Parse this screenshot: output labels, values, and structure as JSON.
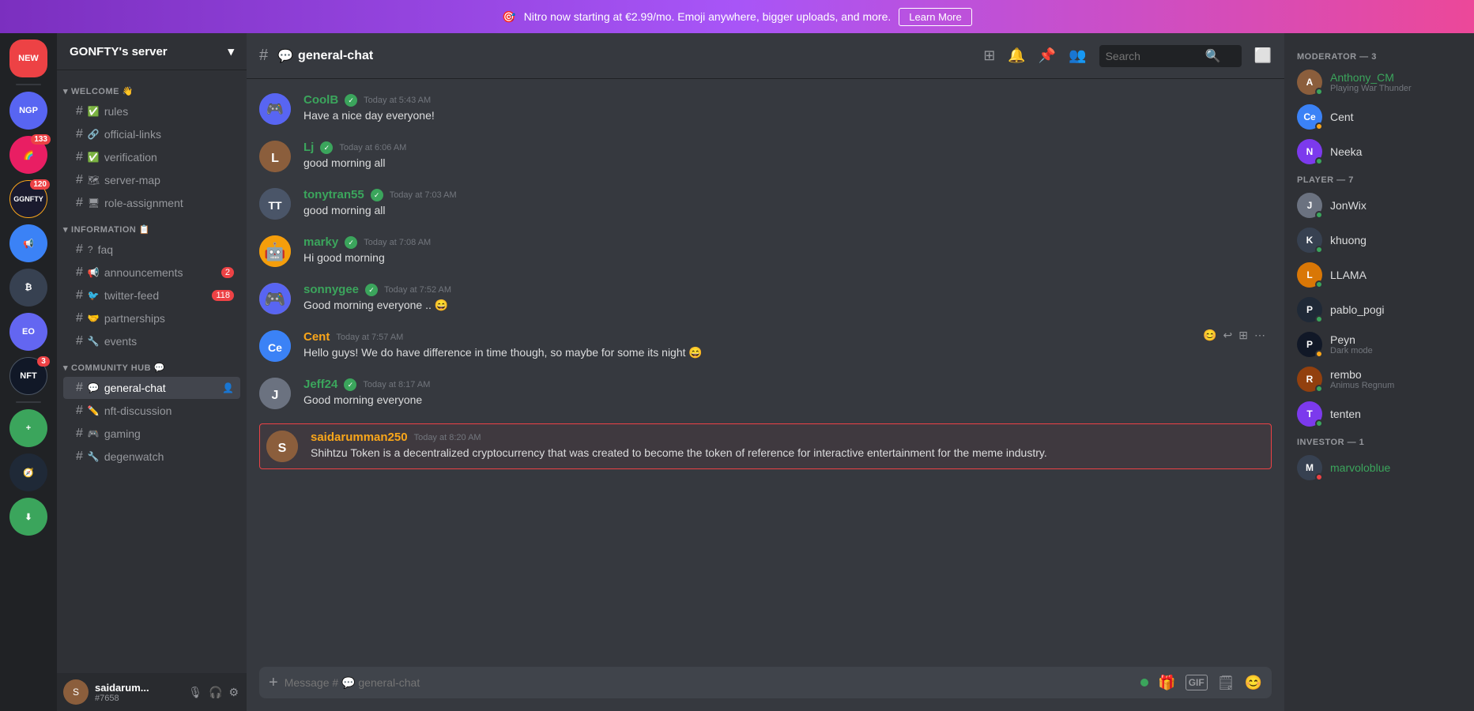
{
  "banner": {
    "text": "Nitro now starting at €2.99/mo. Emoji anywhere, bigger uploads, and more.",
    "cta": "Learn More",
    "icon": "🎯"
  },
  "server": {
    "name": "GONFTY's server",
    "header_icon": "🟡"
  },
  "server_icons": [
    {
      "id": "new",
      "label": "NEW",
      "color": "#ed4245",
      "badge": null
    },
    {
      "id": "ngp",
      "label": "NGP",
      "color": "#5865f2",
      "badge": null
    },
    {
      "id": "arc",
      "label": "🌈",
      "color": "#e91e63",
      "badge": "133"
    },
    {
      "id": "ggnfty",
      "label": "GGNFTY",
      "color": "#1a1a2e",
      "badge": "120"
    },
    {
      "id": "blue",
      "label": "📢",
      "color": "#3b82f6",
      "badge": null
    },
    {
      "id": "btc",
      "label": "₿",
      "color": "#f59e0b",
      "badge": null
    },
    {
      "id": "eo",
      "label": "EO",
      "color": "#6366f1",
      "badge": null
    },
    {
      "id": "nft3",
      "label": "NFT",
      "color": "#111827",
      "badge": "3"
    },
    {
      "id": "add",
      "label": "+",
      "color": "#3ba55c",
      "badge": null
    },
    {
      "id": "compass",
      "label": "🧭",
      "color": "#1f2937",
      "badge": null
    },
    {
      "id": "download",
      "label": "⬇",
      "color": "#3ba55c",
      "badge": null
    }
  ],
  "channels": {
    "welcome": {
      "label": "WELCOME 👋",
      "items": [
        {
          "name": "rules",
          "icon": "✅",
          "hash": true
        },
        {
          "name": "official-links",
          "icon": "🔗",
          "hash": true
        },
        {
          "name": "verification",
          "icon": "✅",
          "hash": true
        },
        {
          "name": "server-map",
          "icon": "🗺",
          "hash": true
        },
        {
          "name": "role-assignment",
          "icon": "🖥",
          "hash": true
        }
      ]
    },
    "information": {
      "label": "INFORMATION 📋",
      "items": [
        {
          "name": "faq",
          "icon": "?",
          "hash": true,
          "badge": null
        },
        {
          "name": "announcements",
          "icon": "📢",
          "hash": true,
          "badge": "2"
        },
        {
          "name": "twitter-feed",
          "icon": "🐦",
          "hash": true,
          "badge": "118"
        },
        {
          "name": "partnerships",
          "icon": "🤝",
          "hash": true,
          "badge": null
        },
        {
          "name": "events",
          "icon": "🔧",
          "hash": true,
          "badge": null
        }
      ]
    },
    "community": {
      "label": "COMMUNITY HUB 💬",
      "items": [
        {
          "name": "general-chat",
          "icon": "💬",
          "hash": true,
          "active": true
        },
        {
          "name": "nft-discussion",
          "icon": "✏️",
          "hash": true
        },
        {
          "name": "gaming",
          "icon": "🎮",
          "hash": true
        },
        {
          "name": "degenwatch",
          "icon": "🔧",
          "hash": true
        }
      ]
    }
  },
  "current_channel": "general-chat",
  "user": {
    "name": "saidarum...",
    "tag": "#7658",
    "color": "#8b5e3c"
  },
  "messages": [
    {
      "id": "msg1",
      "username": "CoolB",
      "username_color": "green",
      "badge": true,
      "timestamp": "Today at 5:43 AM",
      "text": "Have a nice day everyone!",
      "avatar_color": "#5865f2",
      "avatar_text": "C",
      "avatar_type": "discord"
    },
    {
      "id": "msg2",
      "username": "Lj",
      "username_color": "green",
      "badge": true,
      "timestamp": "Today at 6:06 AM",
      "text": "good morning all",
      "avatar_color": "#8b5e3c",
      "avatar_text": "L"
    },
    {
      "id": "msg3",
      "username": "tonytran55",
      "username_color": "green",
      "badge": true,
      "timestamp": "Today at 7:03 AM",
      "text": "good morning all",
      "avatar_color": "#4a5568",
      "avatar_text": "T"
    },
    {
      "id": "msg4",
      "username": "marky",
      "username_color": "green",
      "badge": true,
      "timestamp": "Today at 7:08 AM",
      "text": "Hi good morning",
      "avatar_color": "#f59e0b",
      "avatar_text": "M",
      "avatar_type": "robot"
    },
    {
      "id": "msg5",
      "username": "sonnygee",
      "username_color": "green",
      "badge": true,
      "timestamp": "Today at 7:52 AM",
      "text": "Good morning everyone .. 😄",
      "avatar_color": "#f59e0b",
      "avatar_text": "S",
      "avatar_type": "discord"
    },
    {
      "id": "msg6",
      "username": "Cent",
      "username_color": "orange",
      "badge": false,
      "timestamp": "Today at 7:57 AM",
      "text": "Hello guys! We do have difference in time though, so maybe for some its night 😄",
      "avatar_color": "#3b82f6",
      "avatar_text": "Ce",
      "has_actions": true
    },
    {
      "id": "msg7",
      "username": "Jeff24",
      "username_color": "green",
      "badge": true,
      "timestamp": "Today at 8:17 AM",
      "text": "Good morning everyone",
      "avatar_color": "#6b7280",
      "avatar_text": "J"
    },
    {
      "id": "msg8",
      "username": "saidarumman250",
      "username_color": "orange",
      "badge": false,
      "timestamp": "Today at 8:20 AM",
      "text": "Shihtzu Token is a decentralized cryptocurrency that was created to become the token of reference for interactive entertainment for the meme industry.",
      "avatar_color": "#8b5e3c",
      "avatar_text": "S",
      "highlighted": true
    }
  ],
  "message_input_placeholder": "Message # 💬 general-chat",
  "members": {
    "moderators": {
      "label": "MODERATOR — 3",
      "items": [
        {
          "name": "Anthony_CM",
          "status": "online",
          "subtext": "Playing War Thunder",
          "color": "#8b5e3c"
        },
        {
          "name": "Cent",
          "status": "idle",
          "subtext": null,
          "color": "#3b82f6"
        },
        {
          "name": "Neeka",
          "status": "online",
          "subtext": null,
          "color": "#7c3aed"
        }
      ]
    },
    "players": {
      "label": "PLAYER — 7",
      "items": [
        {
          "name": "JonWix",
          "status": "online",
          "subtext": null,
          "color": "#6b7280"
        },
        {
          "name": "khuong",
          "status": "online",
          "subtext": null,
          "color": "#374151"
        },
        {
          "name": "LLAMA",
          "status": "online",
          "subtext": null,
          "color": "#d97706"
        },
        {
          "name": "pablo_pogi",
          "status": "online",
          "subtext": null,
          "color": "#1f2937"
        },
        {
          "name": "Peyn",
          "status": "idle",
          "subtext": "Dark mode",
          "color": "#111827"
        },
        {
          "name": "rembo",
          "status": "online",
          "subtext": "Animus Regnum",
          "color": "#92400e"
        },
        {
          "name": "tenten",
          "status": "online",
          "subtext": null,
          "color": "#7c3aed"
        }
      ]
    },
    "investors": {
      "label": "INVESTOR — 1",
      "items": [
        {
          "name": "marvoloblue",
          "status": "dnd",
          "subtext": null,
          "color": "#374151"
        }
      ]
    }
  },
  "header": {
    "channel_name": "general-chat",
    "channel_icon": "💬",
    "search_placeholder": "Search"
  }
}
